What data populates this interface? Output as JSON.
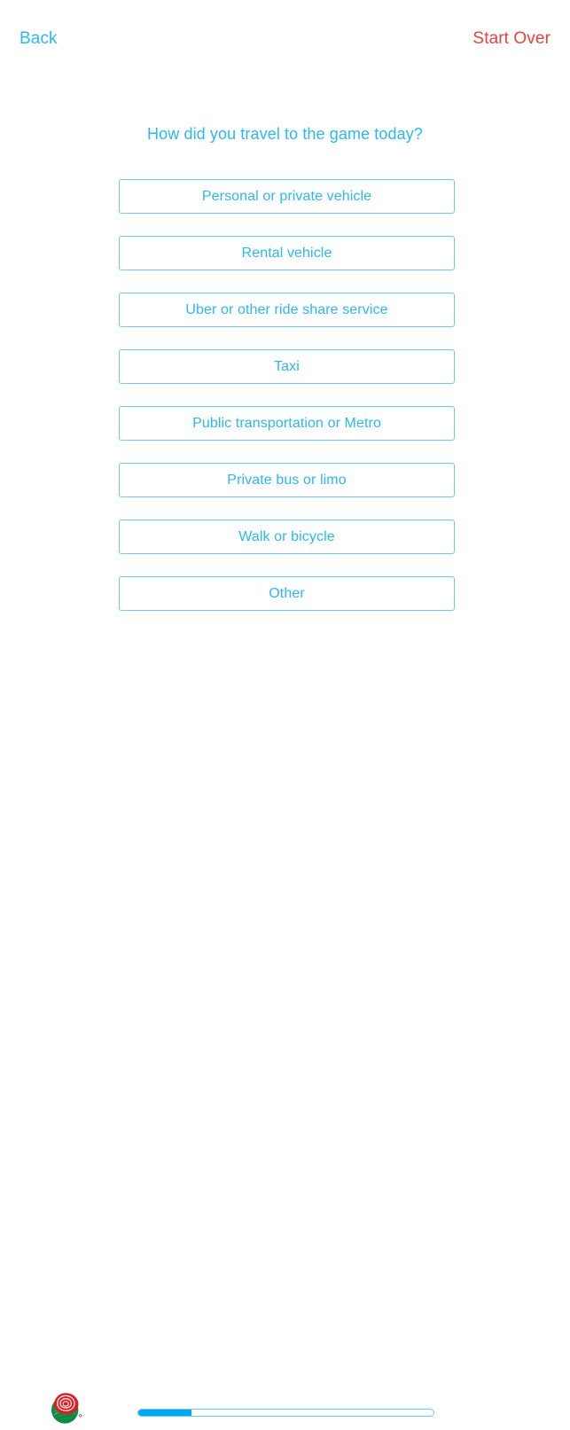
{
  "topbar": {
    "back_label": "Back",
    "start_over_label": "Start Over"
  },
  "survey": {
    "question": "How did you travel to the game today?",
    "options": [
      {
        "label": "Personal or private vehicle"
      },
      {
        "label": "Rental vehicle"
      },
      {
        "label": "Uber or other ride share service"
      },
      {
        "label": "Taxi"
      },
      {
        "label": "Public transportation or Metro"
      },
      {
        "label": "Private bus or limo"
      },
      {
        "label": "Walk or bicycle"
      },
      {
        "label": "Other"
      }
    ]
  },
  "footer": {
    "logo_name": "rose-bowl-logo",
    "progress_percent": 18
  },
  "colors": {
    "accent_blue": "#2bb8f0",
    "border_blue": "#67cdf5",
    "progress_blue": "#00a6f0",
    "danger_red": "#e8423c",
    "logo_red": "#e01b24",
    "logo_green": "#0f8a43",
    "background": "#ffffff"
  }
}
